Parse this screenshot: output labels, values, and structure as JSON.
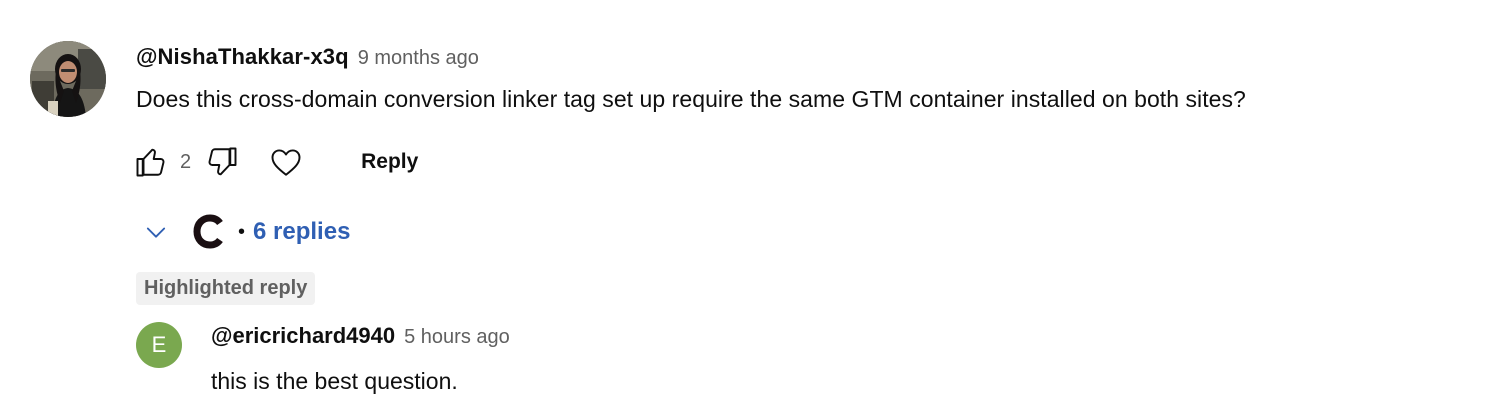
{
  "comment": {
    "author": "@NishaThakkar-x3q",
    "timestamp": "9 months ago",
    "text": "Does this cross-domain conversion linker tag set up require the same GTM container installed on both sites?",
    "like_count": "2",
    "reply_label": "Reply",
    "avatar_icon": "profile-photo",
    "like_icon": "thumbs-up-icon",
    "dislike_icon": "thumbs-down-icon",
    "heart_icon": "heart-icon"
  },
  "replies": {
    "count_label": "6 replies",
    "separator": "•",
    "toggle_icon": "chevron-down-icon",
    "creator_avatar_letter": "C",
    "accent_color": "#2f5fb3"
  },
  "highlighted_reply": {
    "badge": "Highlighted reply",
    "avatar_letter": "E",
    "avatar_color": "#7aa84f",
    "author": "@ericrichard4940",
    "timestamp": "5 hours ago",
    "text": "this is the best question."
  }
}
